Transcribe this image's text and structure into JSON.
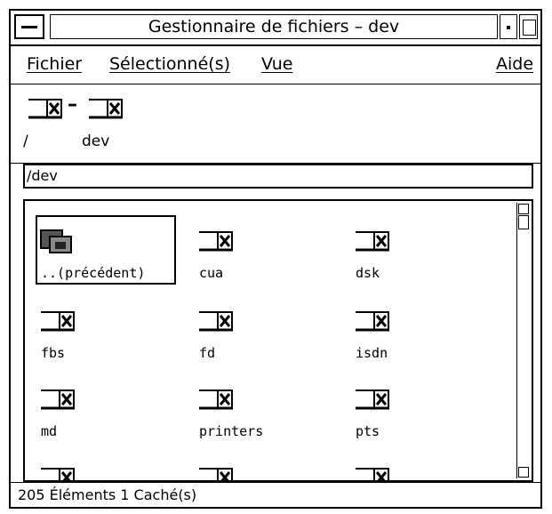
{
  "window": {
    "title": "Gestionnaire de fichiers – dev"
  },
  "menubar": {
    "file": "Fichier",
    "selected": "Sélectionné(s)",
    "view": "Vue",
    "help": "Aide"
  },
  "path": {
    "segments": [
      {
        "label": "/",
        "icon": "folder-icon"
      },
      {
        "label": "dev",
        "icon": "folder-icon"
      }
    ]
  },
  "address": {
    "value": "/dev"
  },
  "files": [
    {
      "name": "..(précédent)",
      "icon": "parent-folder-icon",
      "selected": true
    },
    {
      "name": "cua",
      "icon": "folder-icon"
    },
    {
      "name": "dsk",
      "icon": "folder-icon"
    },
    {
      "name": "fbs",
      "icon": "folder-icon"
    },
    {
      "name": "fd",
      "icon": "folder-icon"
    },
    {
      "name": "isdn",
      "icon": "folder-icon"
    },
    {
      "name": "md",
      "icon": "folder-icon"
    },
    {
      "name": "printers",
      "icon": "folder-icon"
    },
    {
      "name": "pts",
      "icon": "folder-icon"
    },
    {
      "name": "",
      "icon": "folder-icon"
    },
    {
      "name": "",
      "icon": "folder-icon"
    },
    {
      "name": "",
      "icon": "folder-icon"
    }
  ],
  "status": {
    "text": "205 Éléments 1 Caché(s)"
  }
}
